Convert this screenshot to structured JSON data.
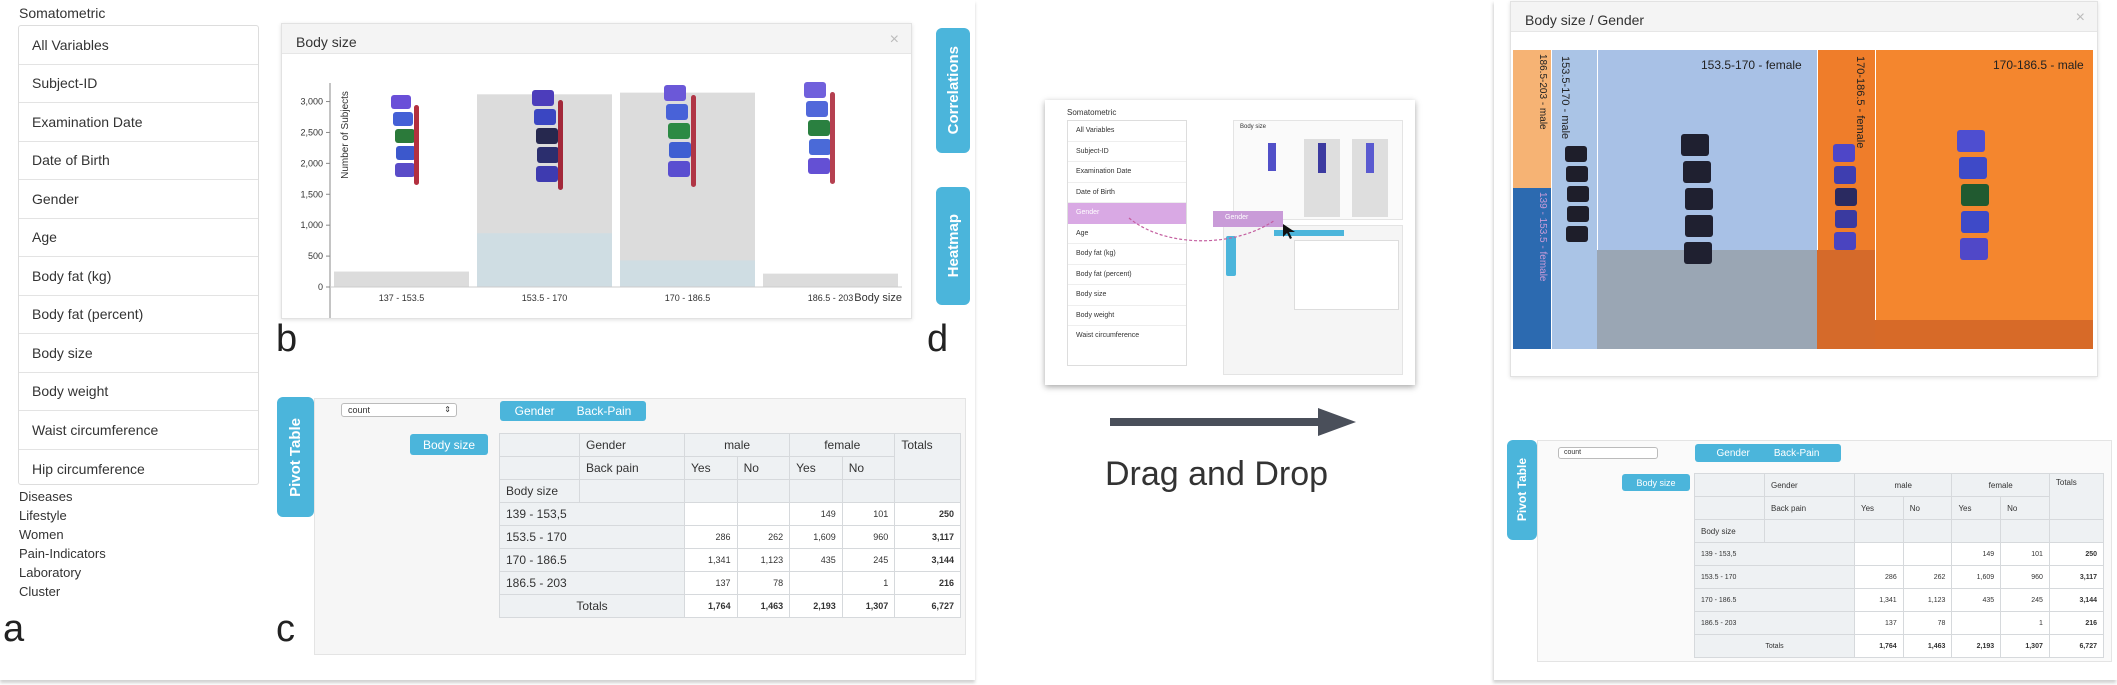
{
  "panel_a": {
    "section_title": "Somatometric",
    "variables": [
      "All Variables",
      "Subject-ID",
      "Examination Date",
      "Date of Birth",
      "Gender",
      "Age",
      "Body fat (kg)",
      "Body fat (percent)",
      "Body size",
      "Body weight",
      "Waist circumference",
      "Hip circumference"
    ],
    "categories": [
      "Diseases",
      "Lifestyle",
      "Women",
      "Pain-Indicators",
      "Laboratory",
      "Cluster"
    ]
  },
  "letters": {
    "a": "a",
    "b": "b",
    "c": "c",
    "d": "d"
  },
  "chart": {
    "title": "Body size",
    "close": "×",
    "y_axis_label": "Number of Subjects",
    "x_axis_label": "Body size"
  },
  "chart_data": {
    "type": "bar",
    "categories": [
      "137 - 153.5",
      "153.5 - 170",
      "170 - 186.5",
      "186.5 - 203"
    ],
    "values": [
      250,
      3117,
      3144,
      216
    ],
    "highlight_values": [
      0,
      870,
      430,
      0
    ],
    "ylim": [
      0,
      3300
    ],
    "yticks": [
      "0",
      "500",
      "1,000",
      "1,500",
      "2,000",
      "2,500",
      "3,000"
    ],
    "xlabel": "Body size",
    "ylabel": "Number of Subjects"
  },
  "side_tabs": {
    "correlations": "Correlations",
    "heatmap": "Heatmap",
    "pivot": "Pivot Table"
  },
  "pivot": {
    "aggregator": "count",
    "row_field": "Body size",
    "col_fields": [
      "Gender",
      "Back-Pain"
    ],
    "header_gender": "Gender",
    "header_backpain": "Back pain",
    "male": "male",
    "female": "female",
    "totals": "Totals",
    "yes": "Yes",
    "no": "No",
    "row_header": "Body size",
    "rows": [
      {
        "label": "139 - 153,5",
        "m_yes": "",
        "m_no": "",
        "f_yes": "149",
        "f_no": "101",
        "total": "250"
      },
      {
        "label": "153.5 - 170",
        "m_yes": "286",
        "m_no": "262",
        "f_yes": "1,609",
        "f_no": "960",
        "total": "3,117"
      },
      {
        "label": "170 - 186.5",
        "m_yes": "1,341",
        "m_no": "1,123",
        "f_yes": "435",
        "f_no": "245",
        "total": "3,144"
      },
      {
        "label": "186.5 - 203",
        "m_yes": "137",
        "m_no": "78",
        "f_yes": "",
        "f_no": "1",
        "total": "216"
      }
    ],
    "totals_row": {
      "label": "Totals",
      "m_yes": "1,764",
      "m_no": "1,463",
      "f_yes": "2,193",
      "f_no": "1,307",
      "total": "6,727"
    }
  },
  "middle": {
    "caption": "Drag and Drop",
    "drag_label": "Gender",
    "mini_title": "Body size"
  },
  "right": {
    "title": "Body size / Gender",
    "close": "×",
    "labels": [
      "153.5-170 - female",
      "170-186.5 - male",
      "153.5-170 - male",
      "170-186.5 - female",
      "186.5-203 - male",
      "139 - 153.5 - female"
    ],
    "pivot_rows": [
      {
        "label": "139 - 153,5",
        "m_yes": "",
        "m_no": "",
        "f_yes": "149",
        "f_no": "101",
        "total": "250"
      },
      {
        "label": "153.5 - 170",
        "m_yes": "286",
        "m_no": "262",
        "f_yes": "1,609",
        "f_no": "960",
        "total": "3,117"
      },
      {
        "label": "170 - 186.5",
        "m_yes": "1,341",
        "m_no": "1,123",
        "f_yes": "435",
        "f_no": "245",
        "total": "3,144"
      },
      {
        "label": "186.5 - 203",
        "m_yes": "137",
        "m_no": "78",
        "f_yes": "",
        "f_no": "1",
        "total": "216"
      }
    ]
  },
  "colors": {
    "accent": "#4bb5db",
    "bar": "#dcdcdc",
    "bar_highlight": "#cfdde3",
    "heat_blue": "#a9c2e8",
    "heat_orange": "#f2842c",
    "heat_dark_blue": "#2b6cb8",
    "heat_light_orange": "#f7b170",
    "drag_purple": "#c99bd8"
  }
}
